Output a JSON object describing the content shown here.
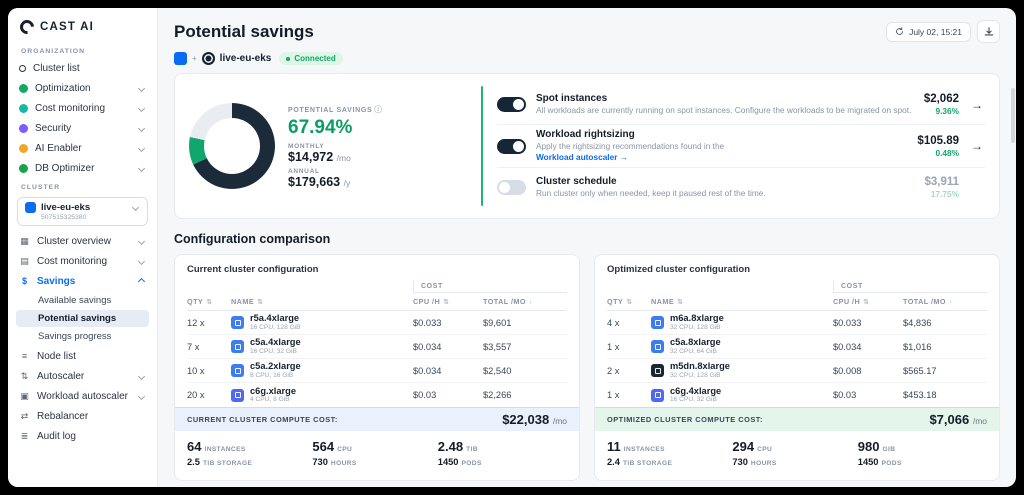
{
  "brand": {
    "name": "CAST AI"
  },
  "icons": {
    "info": "ⓘ",
    "arrow_right": "→",
    "sort": "⇅",
    "sort_desc": "↓",
    "plus": "+"
  },
  "colors": {
    "accent_blue": "#0b6cf3",
    "green": "#12a66f",
    "donut_dark": "#1c2b3a",
    "footer_blue_bg": "#e9f1fc",
    "footer_green_bg": "#e4f6ec"
  },
  "sidebar": {
    "org_section": "ORGANIZATION",
    "org_items": {
      "cluster_list": "Cluster list",
      "optimization": "Optimization",
      "cost_monitoring": "Cost monitoring",
      "security": "Security",
      "ai_enabler": "AI Enabler",
      "db_optimizer": "DB Optimizer"
    },
    "cluster_section": "CLUSTER",
    "cluster_selector": {
      "name": "live-eu-eks",
      "id": "507515325380"
    },
    "nav": {
      "cluster_overview": "Cluster overview",
      "cost_monitoring": "Cost monitoring",
      "savings": "Savings",
      "available_savings": "Available savings",
      "potential_savings": "Potential savings",
      "savings_progress": "Savings progress",
      "node_list": "Node list",
      "autoscaler": "Autoscaler",
      "workload_autoscaler": "Workload autoscaler",
      "rebalancer": "Rebalancer",
      "audit_log": "Audit log"
    }
  },
  "header": {
    "title": "Potential savings",
    "timestamp": "July 02, 15:21"
  },
  "cluster_bar": {
    "name": "live-eu-eks",
    "status": "Connected"
  },
  "savings": {
    "label": "POTENTIAL SAVINGS",
    "percent": "67.94%",
    "monthly_label": "MONTHLY",
    "monthly_value": "$14,972",
    "monthly_unit": "/mo",
    "annual_label": "ANNUAL",
    "annual_value": "$179,663",
    "annual_unit": "/y",
    "items": [
      {
        "title": "Spot instances",
        "desc": "All workloads are currently running on spot instances. Configure the workloads to be migrated on spot.",
        "value": "$2,062",
        "percent": "9.36%",
        "enabled": true
      },
      {
        "title": "Workload rightsizing",
        "desc": "Apply the rightsizing recommendations found in the",
        "link": "Workload autoscaler →",
        "value": "$105.89",
        "percent": "0.48%",
        "enabled": true
      },
      {
        "title": "Cluster schedule",
        "desc": "Run cluster only when needed, keep it paused rest of the time.",
        "value": "$3,911",
        "percent": "17.75%",
        "enabled": false
      }
    ]
  },
  "comparison": {
    "title": "Configuration comparison",
    "columns": {
      "qty": "QTY",
      "name": "NAME",
      "cost_group": "COST",
      "cpu": "CPU /H",
      "total": "TOTAL /MO"
    },
    "current": {
      "title": "Current cluster configuration",
      "rows": [
        {
          "qty": "12 x",
          "name": "r5a.4xlarge",
          "spec": "16 CPU, 128 GiB",
          "cpu": "$0.033",
          "total": "$9,601"
        },
        {
          "qty": "7 x",
          "name": "c5a.4xlarge",
          "spec": "16 CPU, 32 GiB",
          "cpu": "$0.034",
          "total": "$3,557"
        },
        {
          "qty": "10 x",
          "name": "c5a.2xlarge",
          "spec": "8 CPU, 16 GiB",
          "cpu": "$0.034",
          "total": "$2,540"
        },
        {
          "qty": "20 x",
          "name": "c6g.xlarge",
          "spec": "4 CPU, 8 GiB",
          "cpu": "$0.03",
          "total": "$2,266"
        }
      ],
      "footer_label": "CURRENT CLUSTER COMPUTE COST:",
      "footer_value": "$22,038",
      "footer_unit": "/mo",
      "stats_row1": [
        {
          "value": "64",
          "label": "INSTANCES"
        },
        {
          "value": "564",
          "label": "CPU"
        },
        {
          "value": "2.48",
          "label": "TIB"
        }
      ],
      "stats_row2": [
        {
          "value": "2.5",
          "label": "TIB STORAGE"
        },
        {
          "value": "730",
          "label": "HOURS"
        },
        {
          "value": "1450",
          "label": "PODS"
        }
      ]
    },
    "optimized": {
      "title": "Optimized cluster configuration",
      "rows": [
        {
          "qty": "4 x",
          "name": "m6a.8xlarge",
          "spec": "32 CPU, 128 GiB",
          "cpu": "$0.033",
          "total": "$4,836"
        },
        {
          "qty": "1 x",
          "name": "c5a.8xlarge",
          "spec": "32 CPU, 64 GiB",
          "cpu": "$0.034",
          "total": "$1,016"
        },
        {
          "qty": "2 x",
          "name": "m5dn.8xlarge",
          "spec": "32 CPU, 128 GiB",
          "cpu": "$0.008",
          "total": "$565.17"
        },
        {
          "qty": "1 x",
          "name": "c6g.4xlarge",
          "spec": "16 CPU, 32 GiB",
          "cpu": "$0.03",
          "total": "$453.18"
        }
      ],
      "footer_label": "OPTIMIZED CLUSTER COMPUTE COST:",
      "footer_value": "$7,066",
      "footer_unit": "/mo",
      "stats_row1": [
        {
          "value": "11",
          "label": "INSTANCES"
        },
        {
          "value": "294",
          "label": "CPU"
        },
        {
          "value": "980",
          "label": "GIB"
        }
      ],
      "stats_row2": [
        {
          "value": "2.4",
          "label": "TIB STORAGE"
        },
        {
          "value": "730",
          "label": "HOURS"
        },
        {
          "value": "1450",
          "label": "PODS"
        }
      ]
    }
  }
}
